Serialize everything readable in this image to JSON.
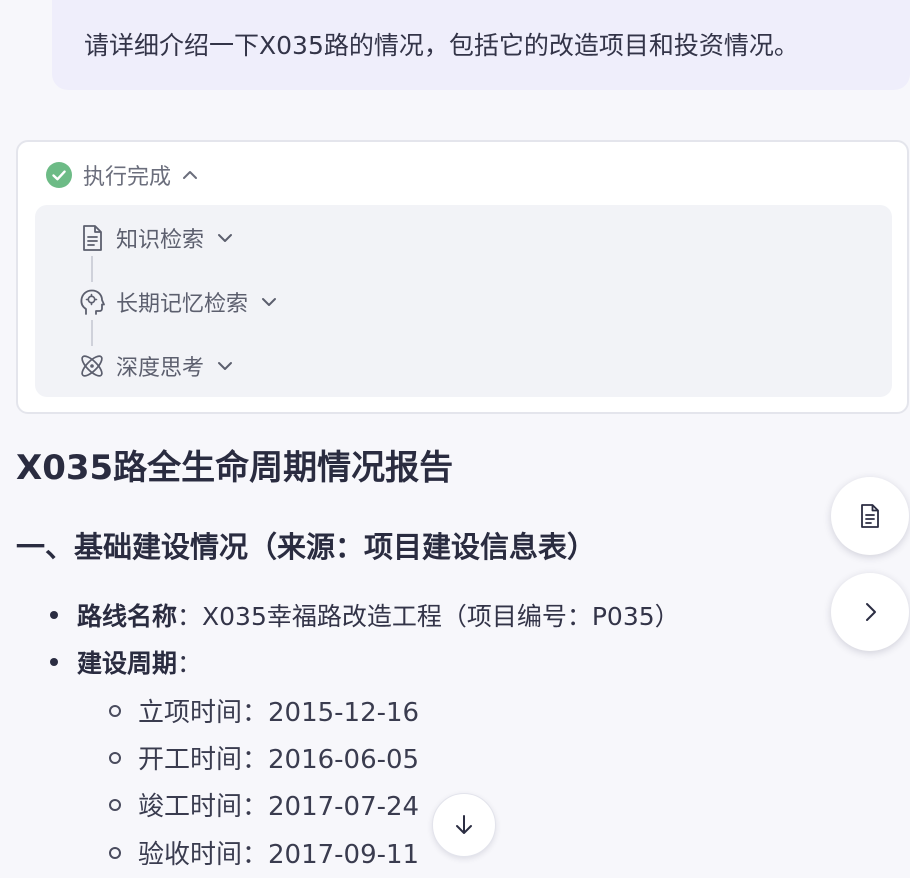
{
  "user_message": "请详细介绍一下X035路的情况，包括它的改造项目和投资情况。",
  "execution": {
    "status_label": "执行完成",
    "steps": [
      {
        "label": "知识检索",
        "icon": "document-icon"
      },
      {
        "label": "长期记忆检索",
        "icon": "head-memory-icon"
      },
      {
        "label": "深度思考",
        "icon": "atom-icon"
      }
    ]
  },
  "report": {
    "title": "X035路全生命周期情况报告",
    "section1": {
      "title": "一、基础建设情况（来源：项目建设信息表）",
      "route_name_label": "路线名称",
      "route_name_value": "：X035幸福路改造工程（项目编号：P035）",
      "period_label": "建设周期",
      "period_colon": "：",
      "dates": [
        "立项时间：2015-12-16",
        "开工时间：2016-06-05",
        "竣工时间：2017-07-24",
        "验收时间：2017-09-11"
      ]
    }
  },
  "colors": {
    "success": "#6dbb86",
    "bubble": "#efeefb",
    "background": "#f7f7fb"
  }
}
